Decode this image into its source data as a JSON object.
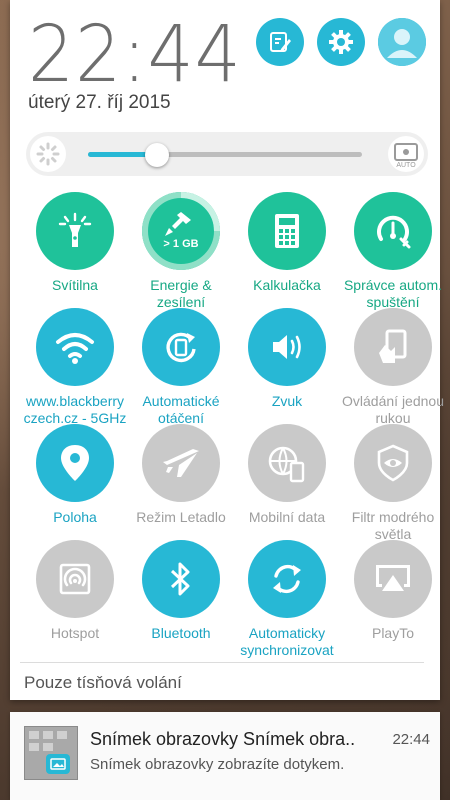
{
  "header": {
    "time": "22:44",
    "date": "úterý 27. říj 2015",
    "buttons": [
      {
        "name": "edit-tiles",
        "icon": "edit-icon"
      },
      {
        "name": "settings",
        "icon": "gear-icon"
      },
      {
        "name": "user-profile",
        "icon": "avatar-icon"
      }
    ]
  },
  "brightness": {
    "level": 0.25,
    "auto_label": "AUTO"
  },
  "tiles": [
    {
      "label": "Svítilna",
      "icon": "flashlight-icon",
      "state": "on"
    },
    {
      "label": "Energie & zesílení",
      "icon": "boost-icon",
      "state": "on",
      "badge": "> 1 GB"
    },
    {
      "label": "Kalkulačka",
      "icon": "calculator-icon",
      "state": "on"
    },
    {
      "label": "Správce autom. spuštění",
      "icon": "autostart-icon",
      "state": "on"
    },
    {
      "label": "www.blackberry czech.cz - 5GHz",
      "icon": "wifi-icon",
      "state": "on-blue"
    },
    {
      "label": "Automatické otáčení",
      "icon": "rotate-icon",
      "state": "on-blue"
    },
    {
      "label": "Zvuk",
      "icon": "sound-icon",
      "state": "on-blue"
    },
    {
      "label": "Ovládání jednou rukou",
      "icon": "one-hand-icon",
      "state": "off"
    },
    {
      "label": "Poloha",
      "icon": "location-icon",
      "state": "on-blue"
    },
    {
      "label": "Režim Letadlo",
      "icon": "airplane-icon",
      "state": "off"
    },
    {
      "label": "Mobilní data",
      "icon": "mobile-data-icon",
      "state": "off"
    },
    {
      "label": "Filtr modrého světla",
      "icon": "eye-filter-icon",
      "state": "off"
    },
    {
      "label": "Hotspot",
      "icon": "hotspot-icon",
      "state": "off"
    },
    {
      "label": "Bluetooth",
      "icon": "bluetooth-icon",
      "state": "on-blue"
    },
    {
      "label": "Automaticky synchronizovat",
      "icon": "sync-icon",
      "state": "on-blue"
    },
    {
      "label": "PlayTo",
      "icon": "cast-icon",
      "state": "off"
    }
  ],
  "emergency_text": "Pouze tísňová volání",
  "notification": {
    "title": "Snímek obrazovky Snímek obra..",
    "text": "Snímek obrazovky zobrazíte dotykem.",
    "time": "22:44"
  },
  "colors": {
    "accent_blue": "#27b8d5",
    "accent_green": "#1fc29a",
    "inactive_gray": "#c9c9c9"
  }
}
